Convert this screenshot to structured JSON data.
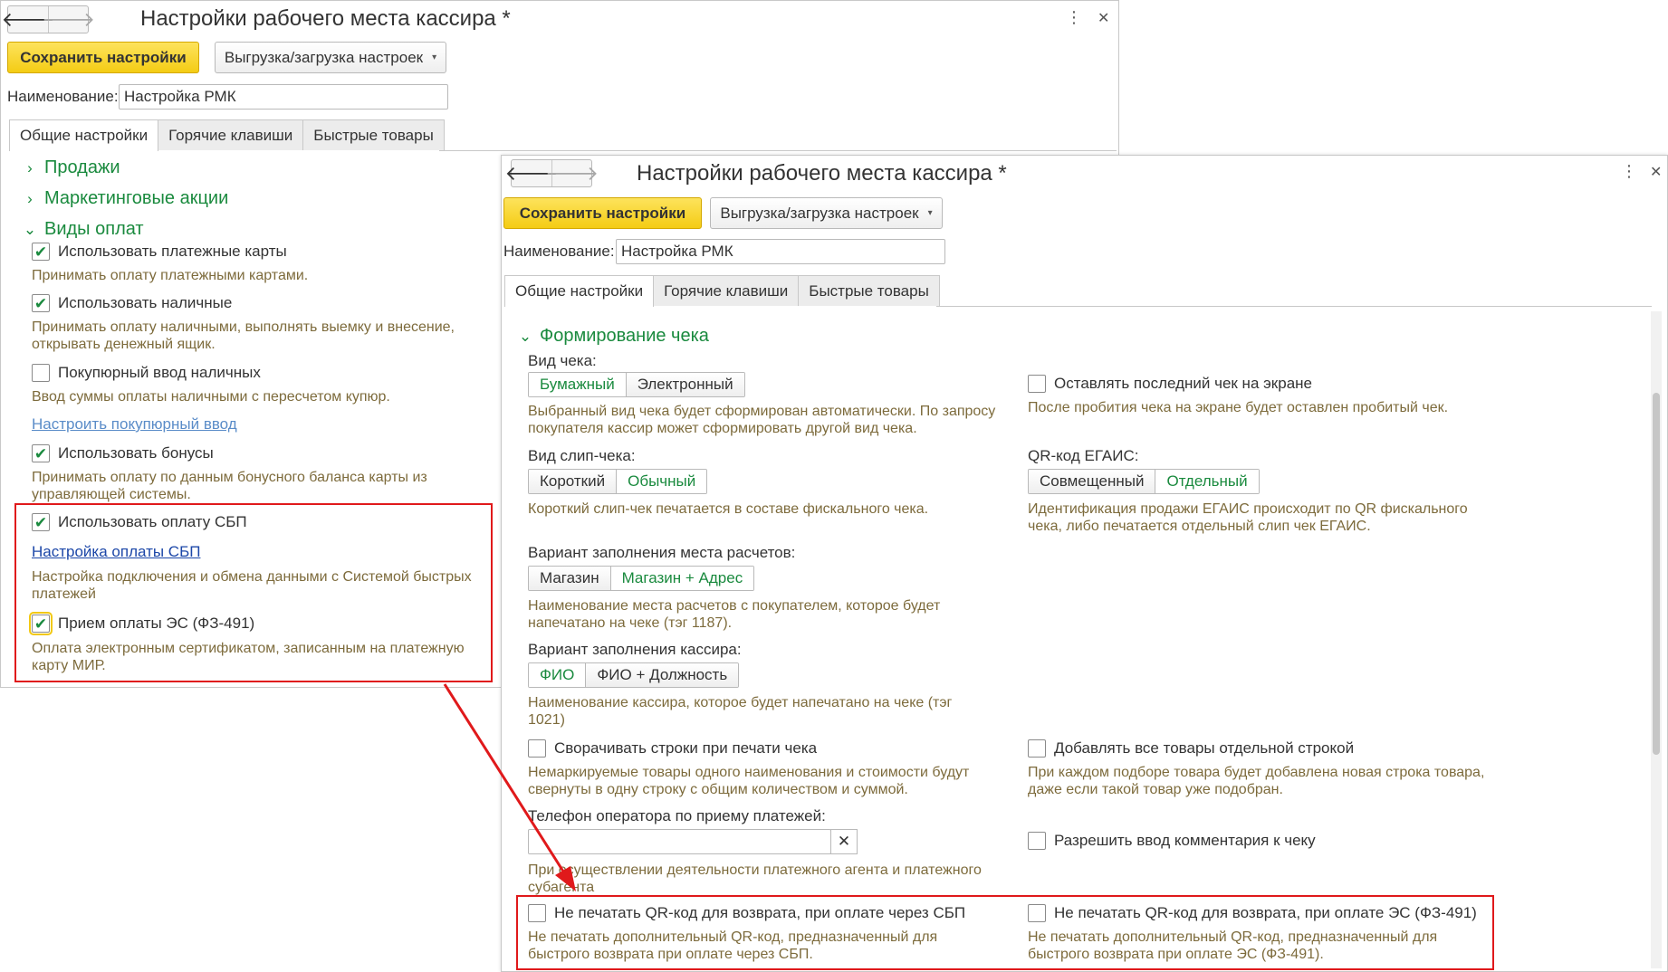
{
  "window1": {
    "title": "Настройки рабочего места кассира *",
    "save_button": "Сохранить настройки",
    "export_button": "Выгрузка/загрузка настроек",
    "name_label": "Наименование:",
    "name_value": "Настройка РМК",
    "tabs": [
      "Общие настройки",
      "Горячие клавиши",
      "Быстрые товары"
    ],
    "groups": {
      "sales": "Продажи",
      "marketing": "Маркетинговые акции",
      "payments": "Виды оплат"
    },
    "items": [
      {
        "label": "Использовать платежные карты",
        "checked": true,
        "hint": "Принимать оплату платежными картами."
      },
      {
        "label": "Использовать наличные",
        "checked": true,
        "hint": "Принимать оплату наличными, выполнять выемку и внесение, открывать денежный ящик."
      },
      {
        "label": "Покупюрный ввод наличных",
        "checked": false,
        "hint": "Ввод суммы оплаты наличными с пересчетом купюр."
      },
      {
        "label": "Использовать бонусы",
        "checked": true,
        "hint": "Принимать оплату по данным бонусного баланса карты из управляющей системы."
      },
      {
        "label": "Использовать оплату СБП",
        "checked": true,
        "hint": "Настройка подключения и обмена данными с Системой быстрых платежей"
      },
      {
        "label": "Прием оплаты ЭС (ФЗ-491)",
        "checked": true,
        "hint": "Оплата электронным сертификатом, записанным на платежную карту МИР."
      }
    ],
    "link_banknote": "Настроить покупюрный ввод",
    "link_sbp": "Настройка оплаты СБП"
  },
  "window2": {
    "title": "Настройки рабочего места кассира *",
    "save_button": "Сохранить настройки",
    "export_button": "Выгрузка/загрузка настроек",
    "name_label": "Наименование:",
    "name_value": "Настройка РМК",
    "tabs": [
      "Общие настройки",
      "Горячие клавиши",
      "Быстрые товары"
    ],
    "group": "Формирование чека",
    "receipt_type": {
      "label": "Вид чека:",
      "options": [
        "Бумажный",
        "Электронный"
      ],
      "selected": "Бумажный",
      "hint": "Выбранный вид чека будет сформирован автоматически. По запросу покупателя кассир может сформировать другой вид чека."
    },
    "keep_last": {
      "label": "Оставлять последний чек на экране",
      "checked": false,
      "hint": "После пробития чека на экране будет оставлен пробитый чек."
    },
    "slip_type": {
      "label": "Вид слип-чека:",
      "options": [
        "Короткий",
        "Обычный"
      ],
      "selected": "Обычный",
      "hint": "Короткий слип-чек печатается  в составе фискального чека."
    },
    "egais_qr": {
      "label": "QR-код ЕГАИС:",
      "options": [
        "Совмещенный",
        "Отдельный"
      ],
      "selected": "Отдельный",
      "hint": "Идентификация продажи ЕГАИС происходит по QR фискального чека, либо печатается отдельный слип чек ЕГАИС."
    },
    "place_fill": {
      "label": "Вариант заполнения места расчетов:",
      "options": [
        "Магазин",
        "Магазин + Адрес"
      ],
      "selected": "Магазин + Адрес",
      "hint": "Наименование места расчетов с покупателем, которое будет напечатано на чеке (тэг 1187)."
    },
    "cashier_fill": {
      "label": "Вариант заполнения кассира:",
      "options": [
        "ФИО",
        "ФИО + Должность"
      ],
      "selected": "ФИО",
      "hint": "Наименование кассира, которое будет напечатано на чеке (тэг 1021)"
    },
    "collapse_rows": {
      "label": "Сворачивать строки при печати чека",
      "checked": false,
      "hint": "Немаркируемые товары одного наименования и стоимости будут свернуты в одну строку с общим количеством и суммой."
    },
    "separate_rows": {
      "label": "Добавлять все товары отдельной строкой",
      "checked": false,
      "hint": "При каждом подборе товара будет добавлена новая строка товара, даже если такой товар уже подобран."
    },
    "operator_phone": {
      "label": "Телефон оператора по приему платежей:",
      "value": "",
      "hint": "При осуществлении деятельности платежного агента и платежного субагента"
    },
    "allow_comment": {
      "label": "Разрешить ввод комментария к чеку",
      "checked": false
    },
    "no_qr_sbp": {
      "label": "Не печатать QR-код для возврата, при оплате через СБП",
      "checked": false,
      "hint": "Не печатать дополнительный QR-код, предназначенный для быстрого возврата при оплате через СБП."
    },
    "no_qr_es": {
      "label": "Не печатать QR-код для возврата, при оплате ЭС (ФЗ-491)",
      "checked": false,
      "hint": "Не печатать дополнительный QR-код, предназначенный для быстрого возврата при оплате ЭС (ФЗ-491)."
    }
  },
  "icons": {
    "back": "arrow-left-icon",
    "forward": "arrow-right-icon",
    "more": "more-vertical-icon",
    "close": "close-icon",
    "check": "checkmark-icon",
    "clear": "clear-icon"
  },
  "colors": {
    "accent_green": "#1a8a3e",
    "save_yellow": "#f4cc14",
    "highlight_red": "#e0191b",
    "hint_text": "#7d6b3c",
    "link_blue": "#1c47a8"
  },
  "glyphs": {
    "back": "🡐",
    "forward": "🡒",
    "more": "⋮",
    "close": "✕",
    "check": "✔",
    "chev_right": "›",
    "chev_down": "⌄",
    "caret": "▾",
    "clear": "✕"
  }
}
